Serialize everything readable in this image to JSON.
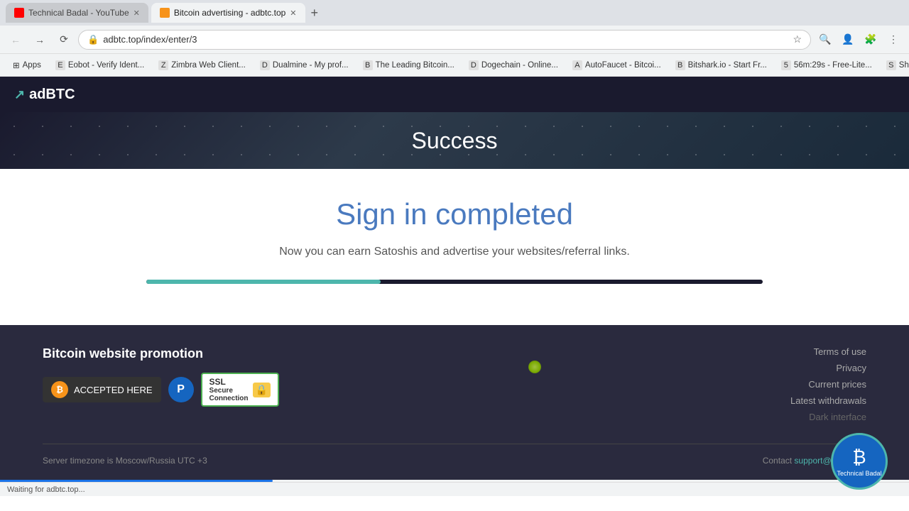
{
  "browser": {
    "tabs": [
      {
        "id": "tab-youtube",
        "label": "Technical Badal - YouTube",
        "favicon_color": "#ff0000",
        "active": false
      },
      {
        "id": "tab-adbtc",
        "label": "Bitcoin advertising - adbtc.top",
        "favicon_color": "#f7931a",
        "active": true
      }
    ],
    "address": "adbtc.top/index/enter/3",
    "loading_status": "Waiting for adbtc.top..."
  },
  "bookmarks": [
    {
      "label": "Apps",
      "is_folder": true
    },
    {
      "label": "Eobot - Verify Ident...",
      "favicon": "E"
    },
    {
      "label": "Zimbra Web Client...",
      "favicon": "Z"
    },
    {
      "label": "Dualmine - My prof...",
      "favicon": "D"
    },
    {
      "label": "The Leading Bitcoin...",
      "favicon": "B"
    },
    {
      "label": "Dogechain - Online...",
      "favicon": "D"
    },
    {
      "label": "AutoFaucet - Bitcoi...",
      "favicon": "A"
    },
    {
      "label": "Bitshark.io - Start Fr...",
      "favicon": "B"
    },
    {
      "label": "56m:29s - Free-Lite...",
      "favicon": "5"
    },
    {
      "label": "Shortlinks | BTC Fau...",
      "favicon": "S"
    }
  ],
  "site": {
    "logo_text": "adBTC",
    "hero_title": "Success",
    "main_title": "Sign in completed",
    "main_subtitle": "Now you can earn Satoshis and advertise your websites/referral links.",
    "progress_percent": 38
  },
  "footer": {
    "promo_title": "Bitcoin website promotion",
    "btc_badge_text": "ACCEPTED HERE",
    "payeer_letter": "P",
    "ssl_line1": "SSL",
    "ssl_line2": "Secure",
    "ssl_line3": "Connection",
    "links": [
      {
        "label": "Terms of use",
        "dark": false
      },
      {
        "label": "Privacy",
        "dark": false
      },
      {
        "label": "Current prices",
        "dark": false
      },
      {
        "label": "Latest withdrawals",
        "dark": false
      },
      {
        "label": "Dark interface",
        "dark": true
      }
    ],
    "timezone_text": "Server timezone is Moscow/Russia UTC +3",
    "contact_label": "Contact",
    "contact_email": "support@adbtc.top"
  },
  "avatar": {
    "icon": "₿",
    "label": "Technical Badal"
  }
}
